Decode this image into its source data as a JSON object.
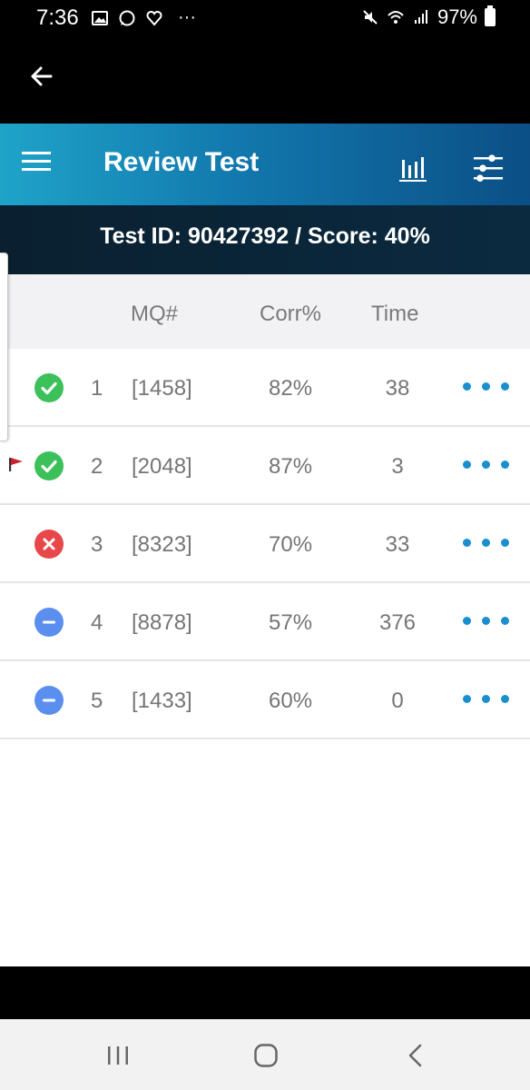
{
  "status_bar": {
    "time": "7:36",
    "battery": "97%",
    "more": "···"
  },
  "header": {
    "title": "Review Test"
  },
  "sub_header": {
    "text": "Test ID: 90427392 / Score: 40%"
  },
  "table": {
    "columns": [
      "MQ#",
      "Corr%",
      "Time"
    ],
    "rows": [
      {
        "status": "correct",
        "flagged": false,
        "num": "1",
        "mq": "[1458]",
        "corr": "82%",
        "time": "38"
      },
      {
        "status": "correct",
        "flagged": true,
        "num": "2",
        "mq": "[2048]",
        "corr": "87%",
        "time": "3"
      },
      {
        "status": "incorrect",
        "flagged": false,
        "num": "3",
        "mq": "[8323]",
        "corr": "70%",
        "time": "33"
      },
      {
        "status": "skipped",
        "flagged": false,
        "num": "4",
        "mq": "[8878]",
        "corr": "57%",
        "time": "376"
      },
      {
        "status": "skipped",
        "flagged": false,
        "num": "5",
        "mq": "[1433]",
        "corr": "60%",
        "time": "0"
      }
    ]
  },
  "colors": {
    "correct": "#3cc05a",
    "incorrect": "#e8474a",
    "skipped": "#5a8ff0",
    "accent": "#1a8fd0",
    "flag": "#c8202c"
  },
  "icons": {
    "back": "arrow-left-icon",
    "menu": "hamburger-icon",
    "chart": "bar-chart-icon",
    "filter": "sliders-icon",
    "more": "more-dots-icon"
  }
}
